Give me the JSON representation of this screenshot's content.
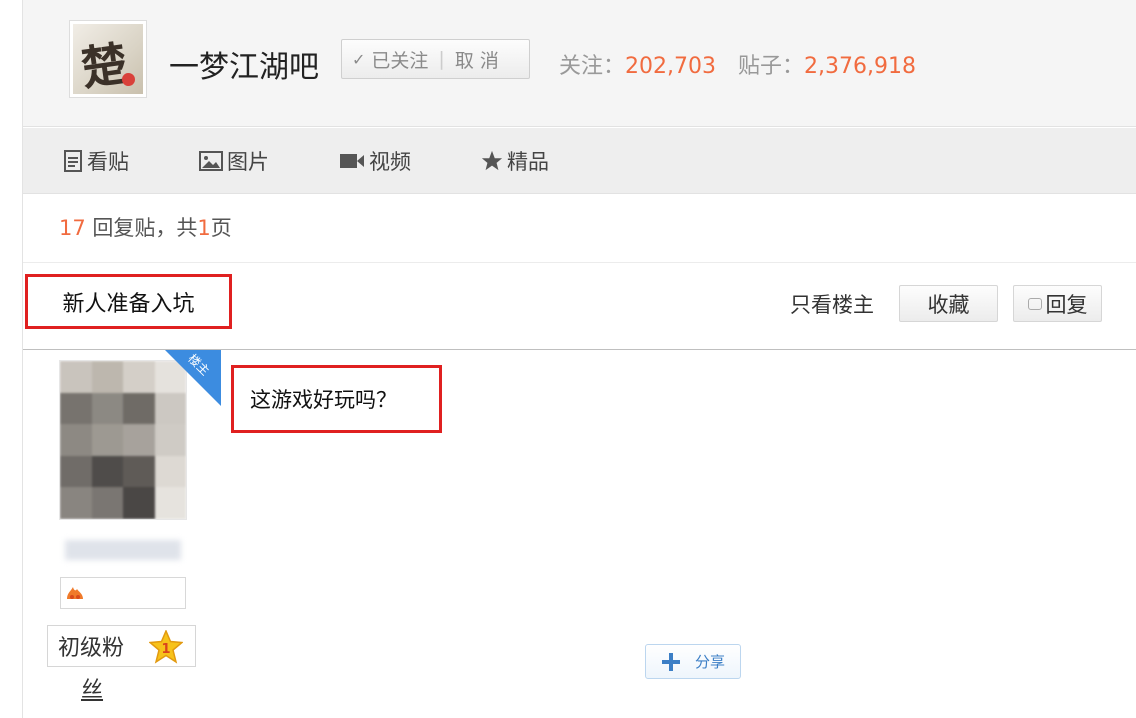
{
  "forum": {
    "name": "一梦江湖吧",
    "logo_char": "楚",
    "follow_state": "已关注",
    "unfollow_label": "取 消",
    "followers_label": "关注：",
    "followers_count": "202,703",
    "posts_label": "贴子：",
    "posts_count": "2,376,918"
  },
  "nav": {
    "items": [
      {
        "label": "看贴",
        "icon": "document-icon"
      },
      {
        "label": "图片",
        "icon": "image-icon"
      },
      {
        "label": "视频",
        "icon": "video-icon"
      },
      {
        "label": "精品",
        "icon": "star-icon"
      }
    ]
  },
  "summary": {
    "reply_count": "17",
    "reply_text": " 回复贴，共",
    "page_count": "1",
    "page_suffix": "页"
  },
  "thread": {
    "title": "新人准备入坑",
    "only_op_label": "只看楼主",
    "favorite_label": "收藏",
    "reply_label": "回复"
  },
  "post": {
    "badge": "楼主",
    "text": "这游戏好玩吗？",
    "level_title": "初级粉",
    "level_title_wrap": "丝",
    "level_number": "1",
    "share_label": "分享"
  },
  "colors": {
    "accent_orange": "#f16b3f",
    "highlight_red": "#e02020",
    "badge_blue": "#3c8ce0"
  }
}
